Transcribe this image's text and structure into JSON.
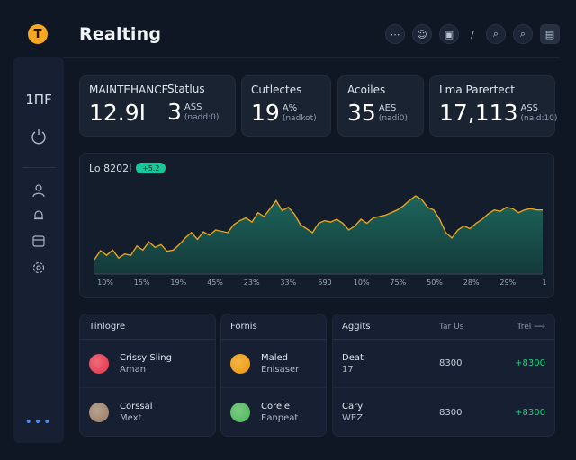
{
  "header": {
    "logo_glyph": "T",
    "title": "Realting",
    "icons": [
      "link-icon",
      "bot-icon",
      "image-icon",
      "slash-icon",
      "search-icon",
      "search-alt-icon",
      "panel-icon"
    ]
  },
  "sidebar": {
    "label": "1ΠF",
    "icons": [
      "power-icon",
      "user-icon",
      "bell-icon",
      "calendar-icon",
      "settings-icon"
    ],
    "more": "•••"
  },
  "stats": [
    {
      "title": "MAINTEHANCE",
      "value": "12.9I",
      "unit": "",
      "sub": ""
    },
    {
      "title": "Statlus",
      "value": "3",
      "unit": "ASS",
      "sub": "(nadd:0)"
    },
    {
      "title": "Cutlectes",
      "value": "19",
      "unit": "A%",
      "sub": "(nadkot)"
    },
    {
      "title": "Acoiles",
      "value": "35",
      "unit": "AES",
      "sub": "(nadi0)"
    },
    {
      "title": "Lma Parertect",
      "value": "17,113",
      "unit": "ASS",
      "sub": "(nald:10)"
    }
  ],
  "chart_data": {
    "type": "area",
    "title": "Lo 8202I",
    "badge": "+5.2",
    "x": [
      "10%",
      "15%",
      "19%",
      "45%",
      "23%",
      "33%",
      "590",
      "10%",
      "75%",
      "50%",
      "28%",
      "29%",
      "1"
    ],
    "values": [
      22,
      35,
      28,
      36,
      24,
      30,
      28,
      42,
      36,
      48,
      40,
      44,
      34,
      36,
      44,
      54,
      62,
      52,
      63,
      58,
      66,
      64,
      62,
      74,
      80,
      84,
      78,
      92,
      86,
      98,
      110,
      95,
      100,
      90,
      74,
      68,
      62,
      76,
      80,
      78,
      82,
      76,
      66,
      72,
      82,
      76,
      84,
      86,
      88,
      92,
      96,
      102,
      110,
      117,
      112,
      100,
      96,
      82,
      62,
      54,
      66,
      72,
      68,
      76,
      82,
      90,
      96,
      94,
      100,
      98,
      92,
      96,
      98,
      96,
      96
    ],
    "ylim": [
      0,
      140
    ],
    "colors": {
      "line": "#e8a21c",
      "fill_top": "#1d6a5f",
      "fill_bottom": "#143d3c"
    }
  },
  "tables": {
    "people": {
      "header": "Tinlogre",
      "rows": [
        {
          "line1": "Crissy Sling",
          "line2": "Aman",
          "avatar": "#e8475b"
        },
        {
          "line1": "Corssal",
          "line2": "Mext",
          "avatar": "#a58b74"
        }
      ]
    },
    "fonts": {
      "header": "Fornis",
      "rows": [
        {
          "line1": "Maled",
          "line2": "Enisaser",
          "avatar": "#f0a21c"
        },
        {
          "line1": "Corele",
          "line2": "Eanpeat",
          "avatar": "#5bbf66"
        }
      ]
    },
    "apps": {
      "header": "Aggits",
      "header_mid": "Tar Us",
      "header_right": "Trel ⟶",
      "rows": [
        {
          "line1": "Deat",
          "line2": "17",
          "amount": "8300",
          "delta": "+8300"
        },
        {
          "line1": "Cary",
          "line2": "WEZ",
          "amount": "8300",
          "delta": "+8300"
        }
      ]
    }
  }
}
